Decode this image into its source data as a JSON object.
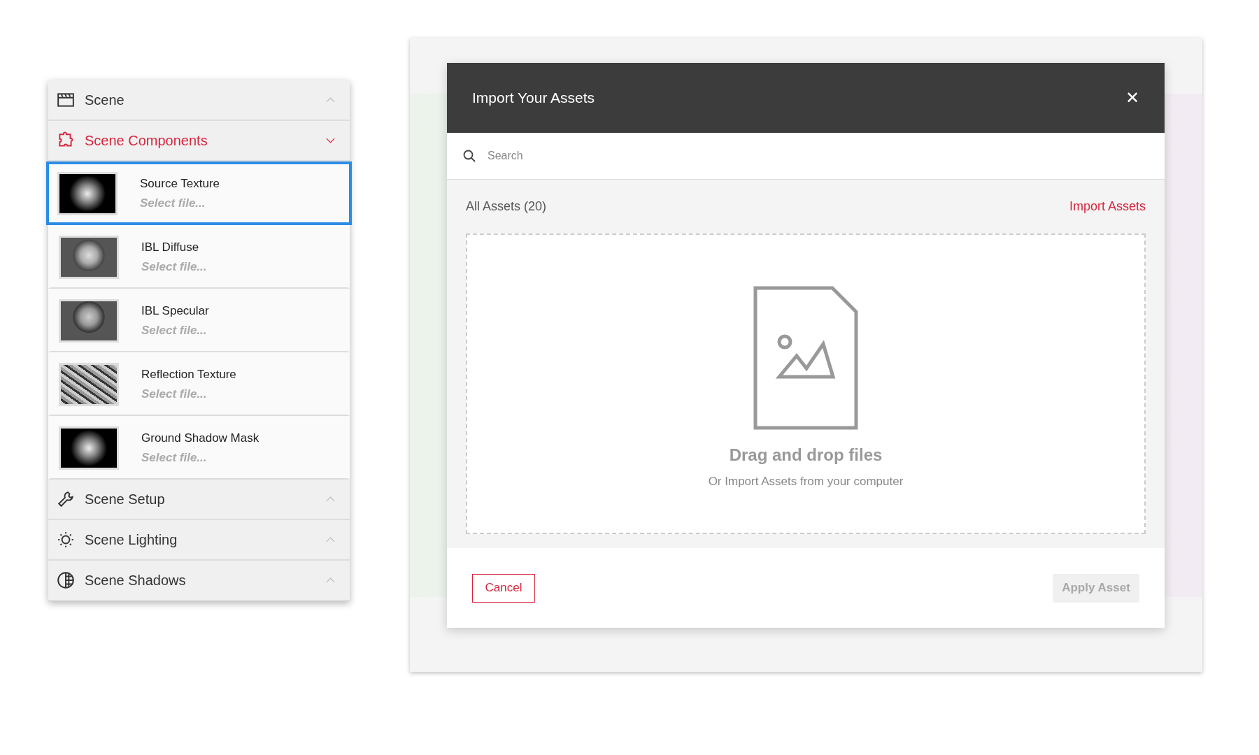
{
  "sidebar": {
    "sections": [
      {
        "label": "Scene",
        "expanded": false
      },
      {
        "label": "Scene Components",
        "expanded": true,
        "items": [
          {
            "title": "Source Texture",
            "subtitle": "Select file...",
            "selected": true
          },
          {
            "title": "IBL Diffuse",
            "subtitle": "Select file...",
            "selected": false
          },
          {
            "title": "IBL Specular",
            "subtitle": "Select file...",
            "selected": false
          },
          {
            "title": "Reflection Texture",
            "subtitle": "Select file...",
            "selected": false
          },
          {
            "title": "Ground Shadow Mask",
            "subtitle": "Select file...",
            "selected": false
          }
        ]
      },
      {
        "label": "Scene Setup",
        "expanded": false
      },
      {
        "label": "Scene Lighting",
        "expanded": false
      },
      {
        "label": "Scene Shadows",
        "expanded": false
      }
    ]
  },
  "dialog": {
    "title": "Import Your Assets",
    "close": "✕",
    "search": {
      "placeholder": "Search"
    },
    "count_label": "All Assets (20)",
    "import_link": "Import Assets",
    "dropzone": {
      "title": "Drag and drop files",
      "subtitle": "Or Import Assets from your computer"
    },
    "buttons": {
      "cancel": "Cancel",
      "apply": {
        "label": "Apply Asset",
        "disabled": true
      }
    }
  }
}
